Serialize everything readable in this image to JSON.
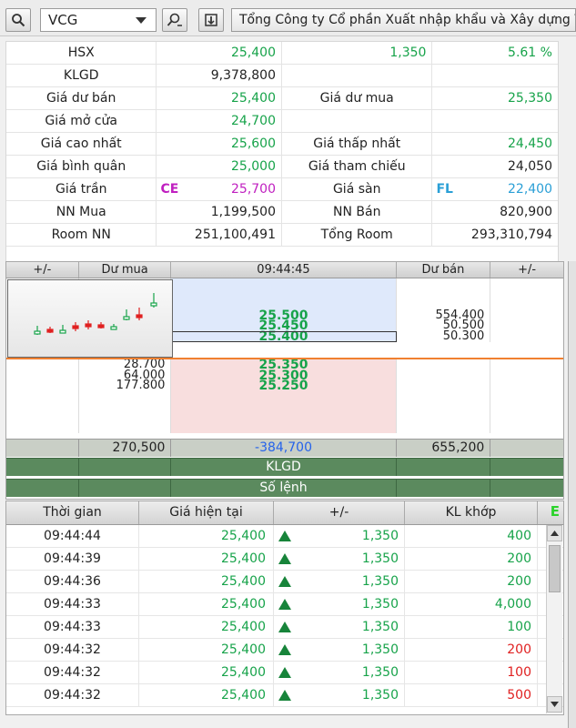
{
  "toolbar": {
    "symbol": "VCG",
    "company_name": "Tổng Công ty Cổ phần Xuất nhập khẩu và Xây dựng Việt Nam"
  },
  "info": [
    {
      "l1": "HSX",
      "v1": "25,400",
      "l2": "1,350",
      "v2": "5.61 %"
    },
    {
      "l1": "KLGD",
      "v1": "9,378,800",
      "l2": "",
      "v2": ""
    },
    {
      "l1": "Giá dư bán",
      "v1": "25,400",
      "l2": "Giá dư mua",
      "v2": "25,350"
    },
    {
      "l1": "Giá mở cửa",
      "v1": "24,700",
      "l2": "",
      "v2": ""
    },
    {
      "l1": "Giá cao nhất",
      "v1": "25,600",
      "l2": "Giá thấp nhất",
      "v2": "24,450"
    },
    {
      "l1": "Giá bình quân",
      "v1": "25,000",
      "l2": "Giá tham chiếu",
      "v2": "24,050"
    },
    {
      "l1": "Giá trần",
      "v1": "25,700",
      "flag1": "CE",
      "l2": "Giá sàn",
      "v2": "22,400",
      "flag2": "FL"
    },
    {
      "l1": "NN Mua",
      "v1": "1,199,500",
      "l2": "NN Bán",
      "v2": "820,900"
    },
    {
      "l1": "Room NN",
      "v1": "251,100,491",
      "l2": "Tổng Room",
      "v2": "293,310,794"
    }
  ],
  "book": {
    "headers": [
      "+/-",
      "Dư mua",
      "09:44:45",
      "Dư bán",
      "+/-"
    ],
    "asks": [
      {
        "price": "",
        "vol": ""
      },
      {
        "price": "",
        "vol": ""
      },
      {
        "price": "",
        "vol": ""
      },
      {
        "price": "25.500",
        "vol": "554.400"
      },
      {
        "price": "25.450",
        "vol": "50.500"
      },
      {
        "price": "25.400",
        "vol": "50.300"
      }
    ],
    "bids": [
      {
        "vol": "28.700",
        "price": "25.350"
      },
      {
        "vol": "64.000",
        "price": "25.300"
      },
      {
        "vol": "177.800",
        "price": "25.250"
      },
      {
        "vol": "",
        "price": ""
      },
      {
        "vol": "",
        "price": ""
      },
      {
        "vol": "",
        "price": ""
      },
      {
        "vol": "",
        "price": ""
      }
    ],
    "total_buy": "270,500",
    "total_diff": "-384,700",
    "total_sell": "655,200",
    "klgd_label": "KLGD",
    "solenh_label": "Số lệnh"
  },
  "trades": {
    "headers": [
      "Thời gian",
      "Giá hiện tại",
      "+/-",
      "KL khớp"
    ],
    "badge": "E",
    "rows": [
      {
        "time": "09:44:44",
        "price": "25,400",
        "change": "1,350",
        "vol": "400",
        "side": "green"
      },
      {
        "time": "09:44:39",
        "price": "25,400",
        "change": "1,350",
        "vol": "200",
        "side": "green"
      },
      {
        "time": "09:44:36",
        "price": "25,400",
        "change": "1,350",
        "vol": "200",
        "side": "green"
      },
      {
        "time": "09:44:33",
        "price": "25,400",
        "change": "1,350",
        "vol": "4,000",
        "side": "green"
      },
      {
        "time": "09:44:33",
        "price": "25,400",
        "change": "1,350",
        "vol": "100",
        "side": "green"
      },
      {
        "time": "09:44:32",
        "price": "25,400",
        "change": "1,350",
        "vol": "200",
        "side": "red"
      },
      {
        "time": "09:44:32",
        "price": "25,400",
        "change": "1,350",
        "vol": "100",
        "side": "red"
      },
      {
        "time": "09:44:32",
        "price": "25,400",
        "change": "1,350",
        "vol": "500",
        "side": "red"
      }
    ]
  },
  "colors": {
    "up": "#17a34a",
    "down": "#e02020",
    "ceiling": "#c020c0",
    "floor": "#2a9fd6"
  }
}
